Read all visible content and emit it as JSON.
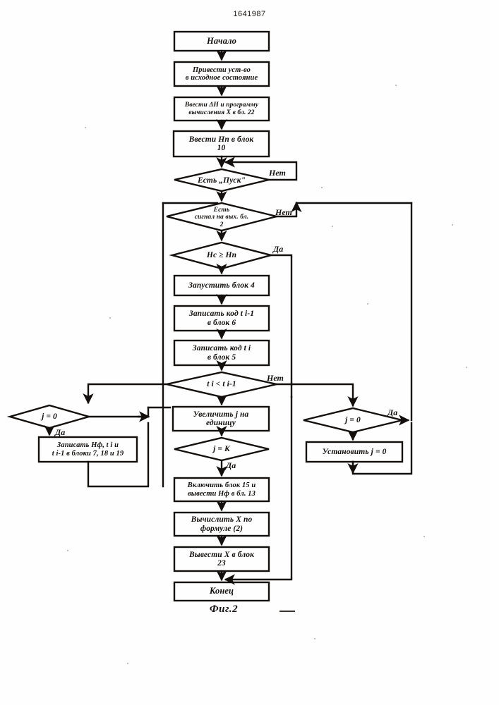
{
  "document": {
    "patent_number": "1641987",
    "figure_caption": "Фиг.2"
  },
  "flowchart": {
    "title": "Фиг.2",
    "nodes": [
      {
        "id": "start",
        "shape": "terminator",
        "label": "Начало"
      },
      {
        "id": "init",
        "shape": "process",
        "label": "Привести уст-во\nв исходное состояние"
      },
      {
        "id": "input_dh",
        "shape": "process",
        "label": "Ввести ΔН и программу\nвычисления Х в бл. 22"
      },
      {
        "id": "input_hp",
        "shape": "process",
        "label": "Ввести Нп в блок\n10"
      },
      {
        "id": "has_start",
        "shape": "decision",
        "label": "Есть „Пуск\""
      },
      {
        "id": "has_signal",
        "shape": "decision",
        "label": "Есть\nсигнал на вых. бл.\n2"
      },
      {
        "id": "hc_ge_hp",
        "shape": "decision",
        "label": "Нс ≥ Нп"
      },
      {
        "id": "run_block4",
        "shape": "process",
        "label": "Запустить блок 4"
      },
      {
        "id": "write_ti1",
        "shape": "process",
        "label": "Записать код t i-1\nв блок 6"
      },
      {
        "id": "write_ti",
        "shape": "process",
        "label": "Записать код t i\nв блок 5"
      },
      {
        "id": "ti_lt_ti1",
        "shape": "decision",
        "label": "t i < t i-1"
      },
      {
        "id": "inc_j",
        "shape": "process",
        "label": "Увеличить j на\nединицу"
      },
      {
        "id": "j_eq_k",
        "shape": "decision",
        "label": "j = K"
      },
      {
        "id": "j_eq_0_left",
        "shape": "decision",
        "label": "j = 0"
      },
      {
        "id": "write_hf",
        "shape": "process",
        "label": "Записать Нф, t i и\nt i-1 в блоки 7, 18 и 19"
      },
      {
        "id": "j_eq_0_right",
        "shape": "decision",
        "label": "j = 0"
      },
      {
        "id": "set_j_0",
        "shape": "process",
        "label": "Установить j = 0"
      },
      {
        "id": "on_block15",
        "shape": "process",
        "label": "Включить блок 15 и\nвывести Нф в бл. 13"
      },
      {
        "id": "calc_x",
        "shape": "process",
        "label": "Вычислить Х по\nформуле (2)"
      },
      {
        "id": "out_x",
        "shape": "process",
        "label": "Вывести Х в блок\n23"
      },
      {
        "id": "end",
        "shape": "terminator",
        "label": "Конец"
      }
    ],
    "edge_labels": [
      {
        "id": "has_start_no",
        "text": "Нет"
      },
      {
        "id": "has_signal_no",
        "text": "Нет"
      },
      {
        "id": "hc_ge_hp_yes",
        "text": "Да"
      },
      {
        "id": "ti_lt_ti1_no",
        "text": "Нет"
      },
      {
        "id": "j_left_yes",
        "text": "Да"
      },
      {
        "id": "j_eq_k_yes",
        "text": "Да"
      },
      {
        "id": "j_right_yes",
        "text": "Да"
      }
    ],
    "colors": {
      "ink": "#120f0d",
      "paper": "#fefefe"
    }
  }
}
